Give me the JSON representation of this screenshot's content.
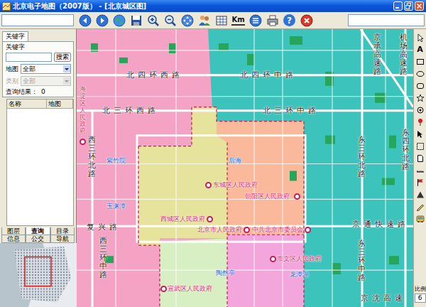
{
  "window": {
    "title": "北京电子地图（2007版） - [北京城区图]"
  },
  "toolbar": {
    "buttons": [
      {
        "kind": "back"
      },
      {
        "kind": "forward"
      },
      {
        "kind": "globe"
      },
      {
        "kind": "save"
      },
      {
        "kind": "zoom-in"
      },
      {
        "kind": "zoom-out"
      },
      {
        "kind": "pan"
      },
      {
        "kind": "find"
      },
      {
        "kind": "layers"
      },
      {
        "kind": "km",
        "label": "Km"
      },
      {
        "kind": "list"
      },
      {
        "kind": "print"
      },
      {
        "kind": "help",
        "glyph": "?"
      },
      {
        "kind": "close"
      }
    ]
  },
  "search_panel": {
    "tab": "关键字",
    "keyword_label": "关键字",
    "keyword_value": "",
    "search_button": "搜索",
    "map_label": "地图",
    "map_value": "全部",
    "category_label": "类别",
    "category_value": "全部",
    "category_disabled": true,
    "results_label": "查询结果：",
    "results_count": "0",
    "columns": [
      "名称",
      "地图"
    ]
  },
  "panel_tabs": [
    {
      "tabs": [
        {
          "label": "图层",
          "selected": false
        },
        {
          "label": "查询",
          "selected": true
        },
        {
          "label": "目录",
          "selected": false
        }
      ]
    },
    {
      "tabs": [
        {
          "label": "信息",
          "selected": false
        },
        {
          "label": "公交",
          "selected": false
        },
        {
          "label": "导航",
          "selected": false
        }
      ]
    }
  ],
  "map": {
    "districts": [
      {
        "color": "#f4a3c4"
      },
      {
        "color": "#3cc4bc"
      },
      {
        "color": "#f9b99a"
      },
      {
        "color": "#e6e39c"
      },
      {
        "color": "#d7efc2"
      },
      {
        "color": "#f3a6dc"
      }
    ],
    "roads": [
      "北四环西路",
      "北四环中路",
      "北三环西路",
      "北三环中路",
      "复兴路",
      "京通快速路",
      "京沈高速",
      "西三环北路",
      "西三环中路",
      "东三环北路",
      "东三环中路",
      "东四环北路",
      "京承高速路",
      "机场高速路"
    ],
    "governments": [
      "海淀区人民政府",
      "东城区人民政府",
      "朝阳区人民政府",
      "西城区人民政府",
      "北京市人民政府",
      "中共北京市委员会",
      "崇文区人民政府",
      "宣武区人民政府"
    ],
    "places": [
      "紫竹院",
      "玉渊潭",
      "后海",
      "陶然亭",
      "龙潭湖"
    ]
  },
  "tools": [
    {
      "kind": "arrow"
    },
    {
      "kind": "text",
      "glyph": "A"
    },
    {
      "kind": "rect"
    },
    {
      "kind": "ellipse"
    },
    {
      "kind": "roundrect"
    },
    {
      "kind": "star"
    },
    {
      "kind": "dot"
    },
    {
      "kind": "pin"
    },
    {
      "kind": "cursor"
    },
    {
      "kind": "select"
    },
    {
      "kind": "doc"
    },
    {
      "kind": "measure"
    },
    {
      "kind": "flag"
    },
    {
      "kind": "triangle"
    },
    {
      "kind": "pencil"
    },
    {
      "kind": "bus"
    }
  ],
  "scale": {
    "label": "比例",
    "value": "6"
  }
}
